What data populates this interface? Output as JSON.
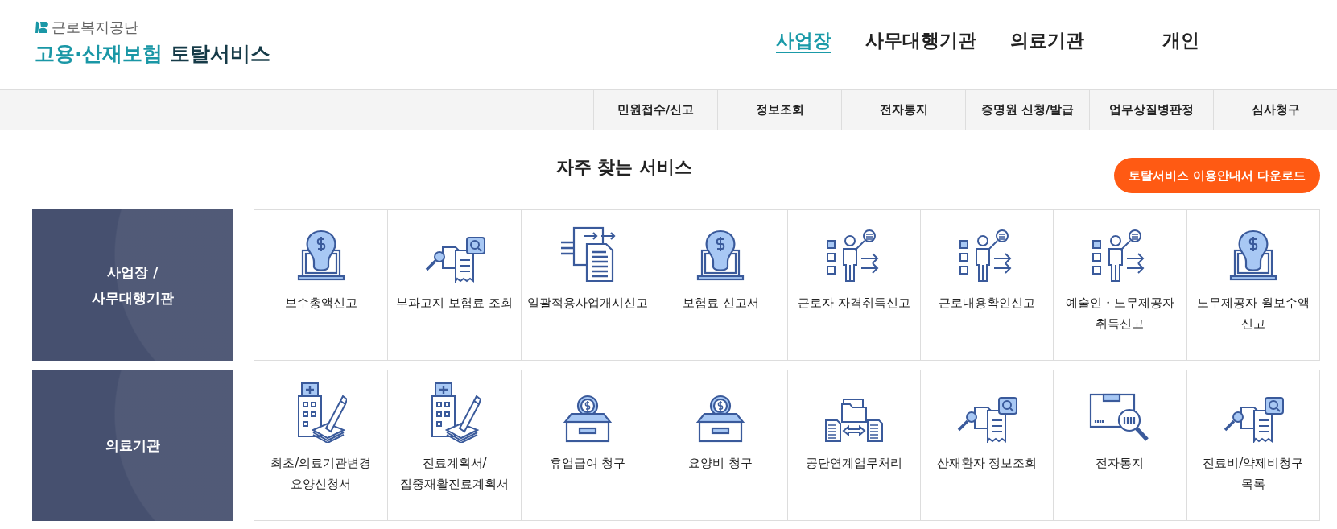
{
  "logo": {
    "org": "근로복지공단",
    "title_accent": "고용·산재보험",
    "title_main": "토탈서비스"
  },
  "top_nav": [
    {
      "label": "사업장",
      "selected": true
    },
    {
      "label": "사무대행기관",
      "selected": false
    },
    {
      "label": "의료기관",
      "selected": false
    },
    {
      "label": "개인",
      "selected": false
    }
  ],
  "sub_nav": [
    "민원접수/신고",
    "정보조회",
    "전자통지",
    "증명원 신청/발급",
    "업무상질병판정",
    "심사청구"
  ],
  "section_title": "자주 찾는 서비스",
  "guide_button": "토탈서비스 이용안내서 다운로드",
  "groups": [
    {
      "category": "사업장 /\n사무대행기관",
      "services": [
        {
          "label": "보수총액신고",
          "kind": "money-laptop"
        },
        {
          "label": "부과고지 보험료 조회",
          "kind": "doc-search"
        },
        {
          "label": "일괄적용사업개시신고",
          "kind": "doc-transfer"
        },
        {
          "label": "보험료 신고서",
          "kind": "money-laptop"
        },
        {
          "label": "근로자 자격취득신고",
          "kind": "person-list"
        },
        {
          "label": "근로내용확인신고",
          "kind": "person-list"
        },
        {
          "label": "예술인・노무제공자 취득신고",
          "kind": "person-list"
        },
        {
          "label": "노무제공자 월보수액 신고",
          "kind": "money-laptop"
        }
      ]
    },
    {
      "category": "의료기관",
      "services": [
        {
          "label": "최초/의료기관변경 요양신청서",
          "kind": "hospital-pen"
        },
        {
          "label": "진료계획서/집중재활진료계획서",
          "kind": "hospital-pen"
        },
        {
          "label": "휴업급여 청구",
          "kind": "coin-box"
        },
        {
          "label": "요양비 청구",
          "kind": "coin-box"
        },
        {
          "label": "공단연계업무처리",
          "kind": "folder-exchange"
        },
        {
          "label": "산재환자 정보조회",
          "kind": "doc-search"
        },
        {
          "label": "전자통지",
          "kind": "box-search"
        },
        {
          "label": "진료비/약제비청구 목록",
          "kind": "doc-search"
        }
      ]
    }
  ]
}
